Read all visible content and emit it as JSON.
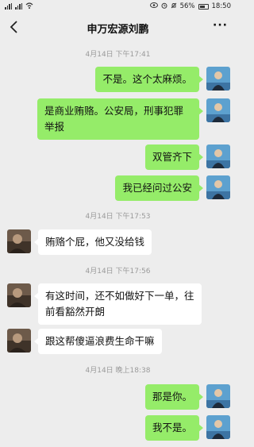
{
  "status_bar": {
    "battery": "56%",
    "time": "18:50"
  },
  "chat": {
    "title": "申万宏源刘鹏",
    "more_label": "···"
  },
  "timestamps": [
    "4月14日 下午17:41",
    "4月14日 下午17:53",
    "4月14日 下午17:56",
    "4月14日 晚上18:38"
  ],
  "messages": [
    {
      "side": "out",
      "text": "不是。这个太麻烦。"
    },
    {
      "side": "out",
      "text": "是商业贿赂。公安局，刑事犯罪举报"
    },
    {
      "side": "out",
      "text": "双管齐下"
    },
    {
      "side": "out",
      "text": "我已经问过公安"
    },
    {
      "side": "in",
      "text": "贿赂个屁，他又没给钱"
    },
    {
      "side": "in",
      "text": "有这时间，还不如做好下一单，往前看豁然开朗"
    },
    {
      "side": "in",
      "text": "跟这帮傻逼浪费生命干嘛"
    },
    {
      "side": "out",
      "text": "那是你。"
    },
    {
      "side": "out",
      "text": "我不是。"
    }
  ]
}
